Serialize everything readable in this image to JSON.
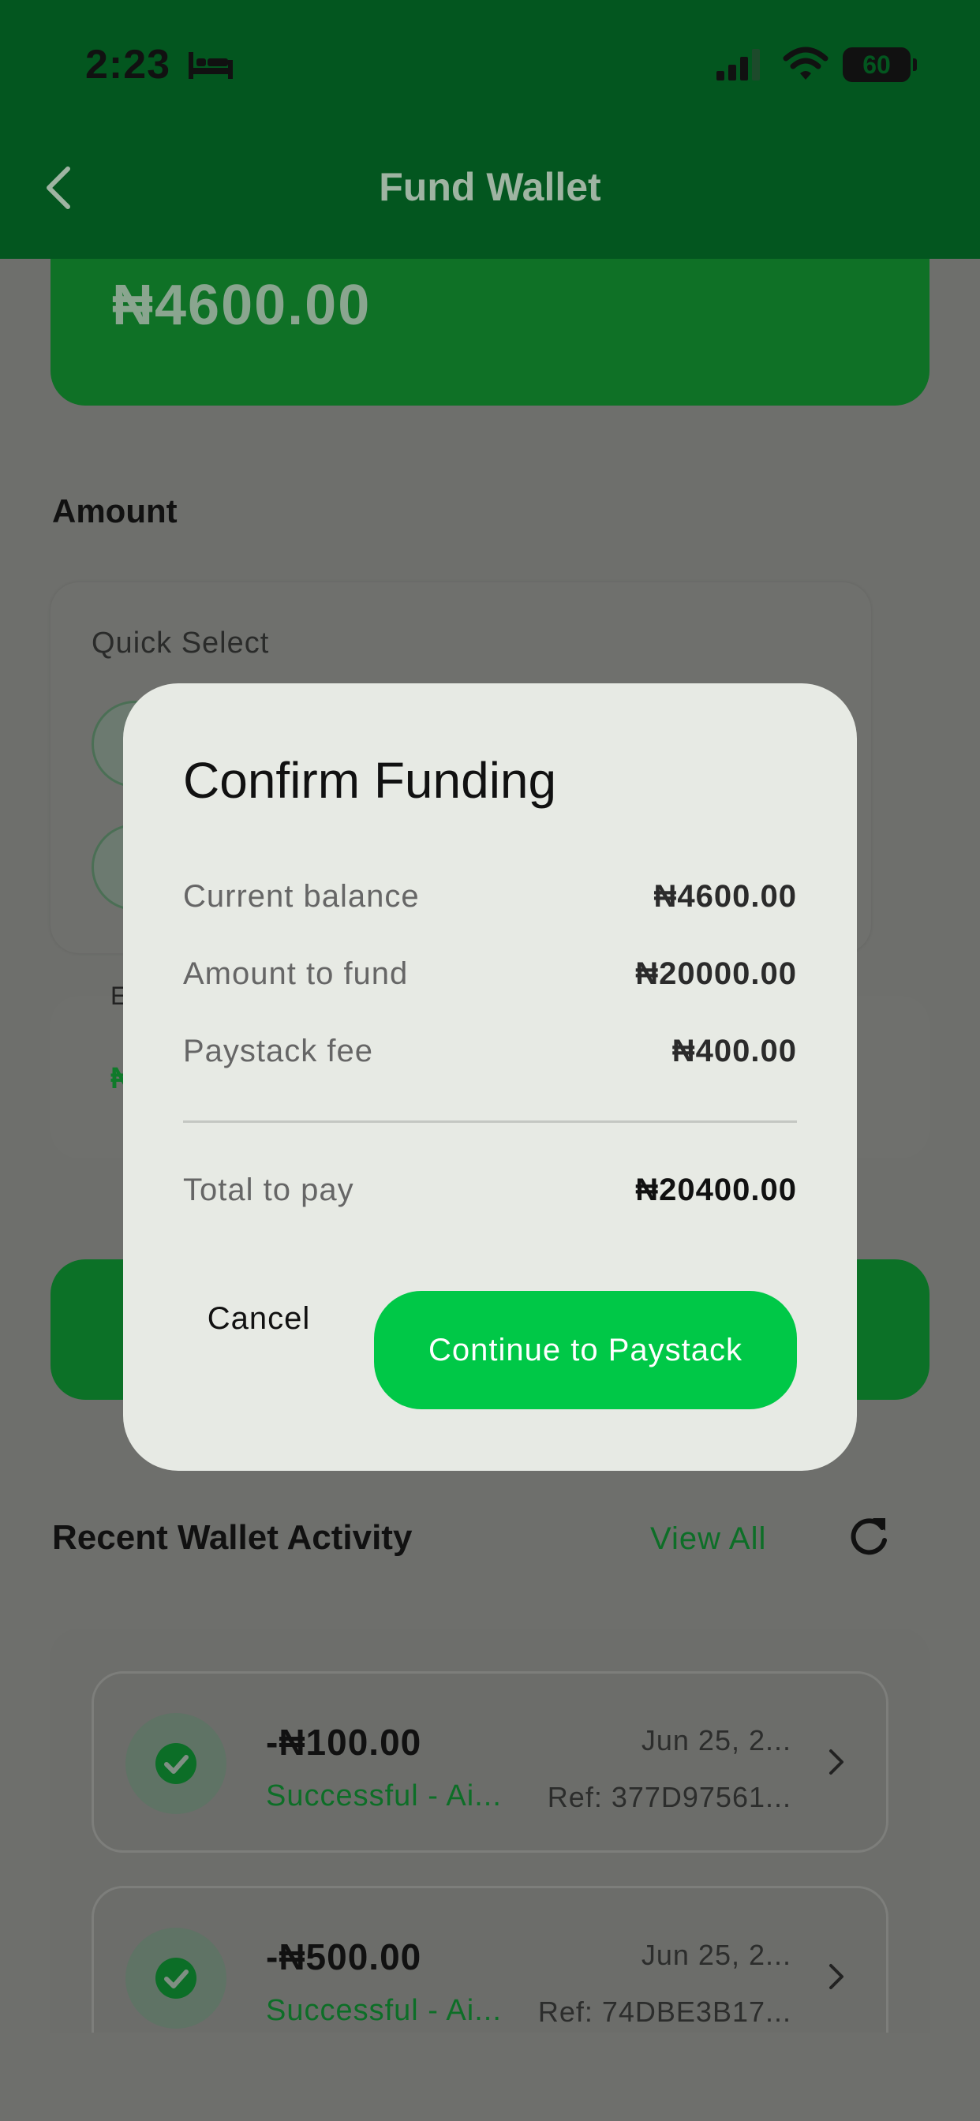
{
  "status_bar": {
    "time": "2:23",
    "battery": "60"
  },
  "app_bar": {
    "title": "Fund Wallet"
  },
  "wallet": {
    "balance": "₦4600.00"
  },
  "amount_section": {
    "label": "Amount",
    "quick_select_label": "Quick Select"
  },
  "fee_card": {
    "partial_label": "E",
    "partial_value": "₦"
  },
  "recent": {
    "title": "Recent Wallet Activity",
    "view_all": "View All",
    "items": [
      {
        "amount": "-₦100.00",
        "status": "Successful - Ai...",
        "date": "Jun 25, 2...",
        "ref": "Ref: 377D97561..."
      },
      {
        "amount": "-₦500.00",
        "status": "Successful - Ai...",
        "date": "Jun 25, 2...",
        "ref": "Ref: 74DBE3B17..."
      }
    ]
  },
  "dialog": {
    "title": "Confirm Funding",
    "rows": [
      {
        "label": "Current balance",
        "value": "₦4600.00"
      },
      {
        "label": "Amount to fund",
        "value": "₦20000.00"
      },
      {
        "label": "Paystack fee",
        "value": "₦400.00"
      }
    ],
    "total": {
      "label": "Total to pay",
      "value": "₦20400.00"
    },
    "cancel_label": "Cancel",
    "continue_label": "Continue to Paystack"
  },
  "colors": {
    "primary_green": "#00c847",
    "dark_green": "#03561f",
    "dialog_bg": "#e7eae4",
    "scrim": "#6e6f6c"
  },
  "icons": [
    "bed-icon",
    "signal-icon",
    "wifi-icon",
    "battery-icon",
    "back-arrow-icon",
    "refresh-icon",
    "check-circle-icon",
    "chevron-right-icon"
  ]
}
